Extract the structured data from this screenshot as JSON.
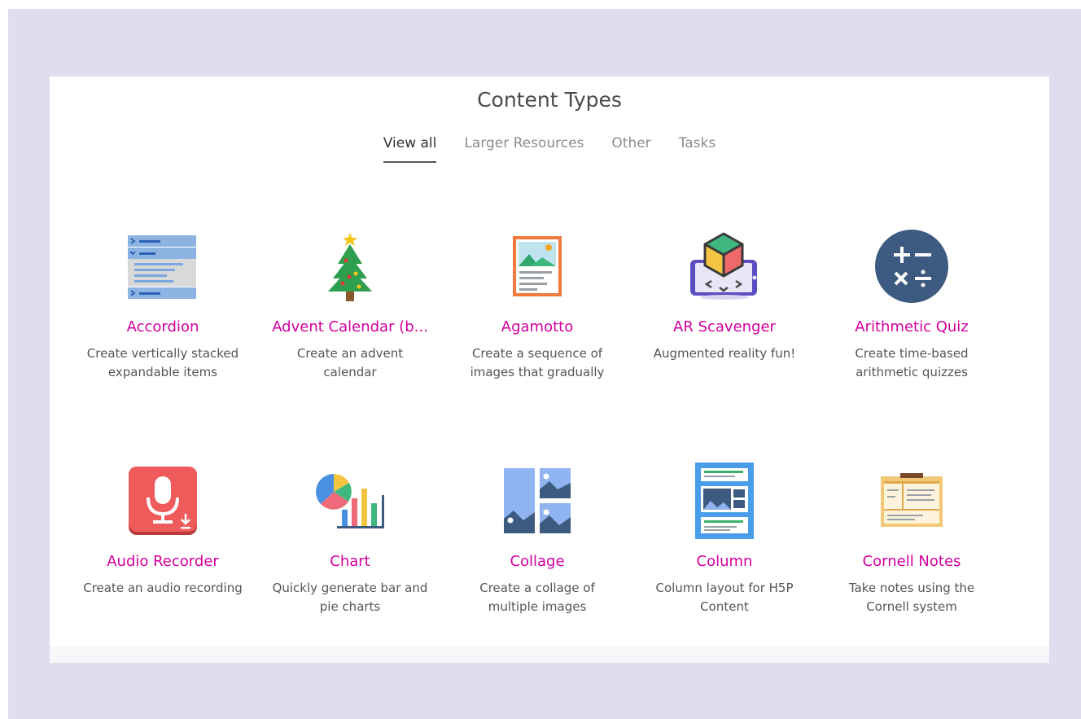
{
  "page": {
    "title": "Content Types"
  },
  "tabs": [
    {
      "label": "View all",
      "active": true
    },
    {
      "label": "Larger Resources",
      "active": false
    },
    {
      "label": "Other",
      "active": false
    },
    {
      "label": "Tasks",
      "active": false
    }
  ],
  "cards": [
    {
      "name": "Accordion",
      "description": "Create vertically stacked expandable items",
      "icon": "accordion-icon"
    },
    {
      "name": "Advent Calendar (b...",
      "description": "Create an advent calendar",
      "icon": "christmas-tree-icon"
    },
    {
      "name": "Agamotto",
      "description": "Create a sequence of images that gradually",
      "icon": "image-sequence-icon"
    },
    {
      "name": "AR Scavenger",
      "description": "Augmented reality fun!",
      "icon": "ar-cube-icon"
    },
    {
      "name": "Arithmetic Quiz",
      "description": "Create time-based arithmetic quizzes",
      "icon": "arithmetic-icon"
    },
    {
      "name": "Audio Recorder",
      "description": "Create an audio recording",
      "icon": "microphone-icon"
    },
    {
      "name": "Chart",
      "description": "Quickly generate bar and pie charts",
      "icon": "chart-icon"
    },
    {
      "name": "Collage",
      "description": "Create a collage of multiple images",
      "icon": "collage-icon"
    },
    {
      "name": "Column",
      "description": "Column layout for H5P Content",
      "icon": "column-icon"
    },
    {
      "name": "Cornell Notes",
      "description": "Take notes using the Cornell system",
      "icon": "notes-icon"
    }
  ],
  "colors": {
    "backdrop": "#dedeef",
    "accent": "#d1009e"
  }
}
